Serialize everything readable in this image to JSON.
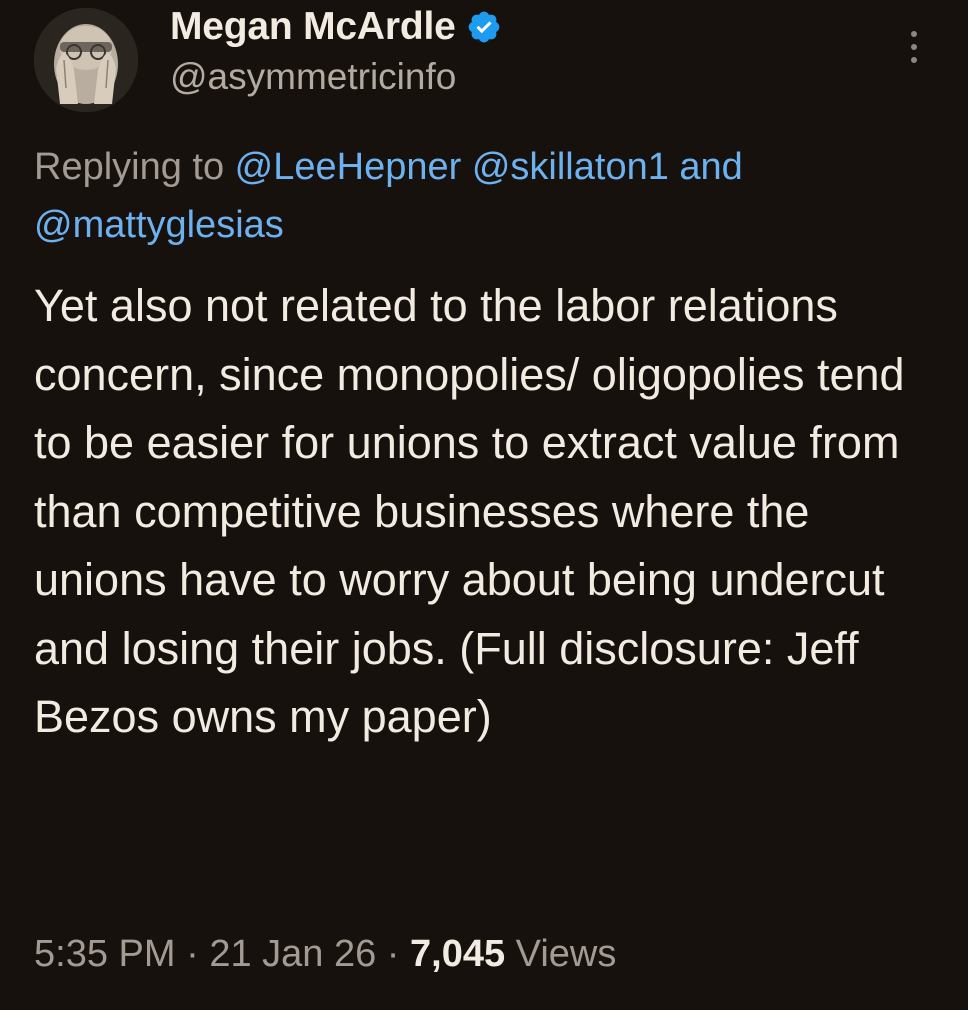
{
  "author": {
    "display_name": "Megan McArdle",
    "handle": "@asymmetricinfo",
    "verified_icon": "verified-badge-icon",
    "avatar_icon": "profile-photo"
  },
  "reply_context": {
    "prefix": "Replying to ",
    "mentions": [
      "@LeeHepner",
      "@skillaton1",
      "@mattyglesias"
    ],
    "separator_space": " ",
    "conjunction": " and"
  },
  "tweet": {
    "text": "Yet also not related to the labor relations concern, since monopolies/ oligopolies tend to be easier for unions to extract value from than competitive businesses where the unions have to worry about being undercut and losing their jobs. (Full disclosure: Jeff Bezos owns my paper)"
  },
  "meta": {
    "time": "5:35 PM",
    "dot": " · ",
    "date": "21 Jan 26",
    "views_count": "7,045",
    "views_label": " Views"
  },
  "menu": {
    "icon": "more-options-icon"
  },
  "colors": {
    "background": "#16110c",
    "text": "#f2ebe2",
    "secondary": "#a39b93",
    "link": "#6cb1f0",
    "verified": "#1d9bf0"
  }
}
